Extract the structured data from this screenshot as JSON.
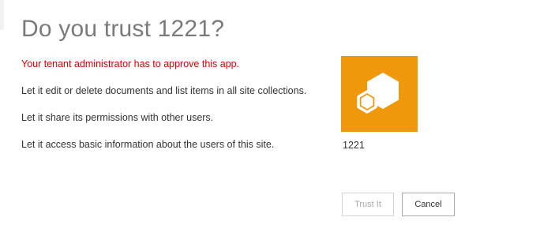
{
  "dialog": {
    "title": "Do you trust 1221?",
    "warning": "Your tenant administrator has to approve this app.",
    "permissions": [
      "Let it edit or delete documents and list items in all site collections.",
      "Let it share its permissions with other users.",
      "Let it access basic information about the users of this site."
    ]
  },
  "app": {
    "name": "1221",
    "icon": "app-hexagon-icon",
    "tile_color": "#f0980c"
  },
  "buttons": {
    "trust_label": "Trust It",
    "cancel_label": "Cancel"
  },
  "colors": {
    "warning": "#e00000",
    "title": "#7a7a7a",
    "disabled_text": "#a8a8a8"
  }
}
